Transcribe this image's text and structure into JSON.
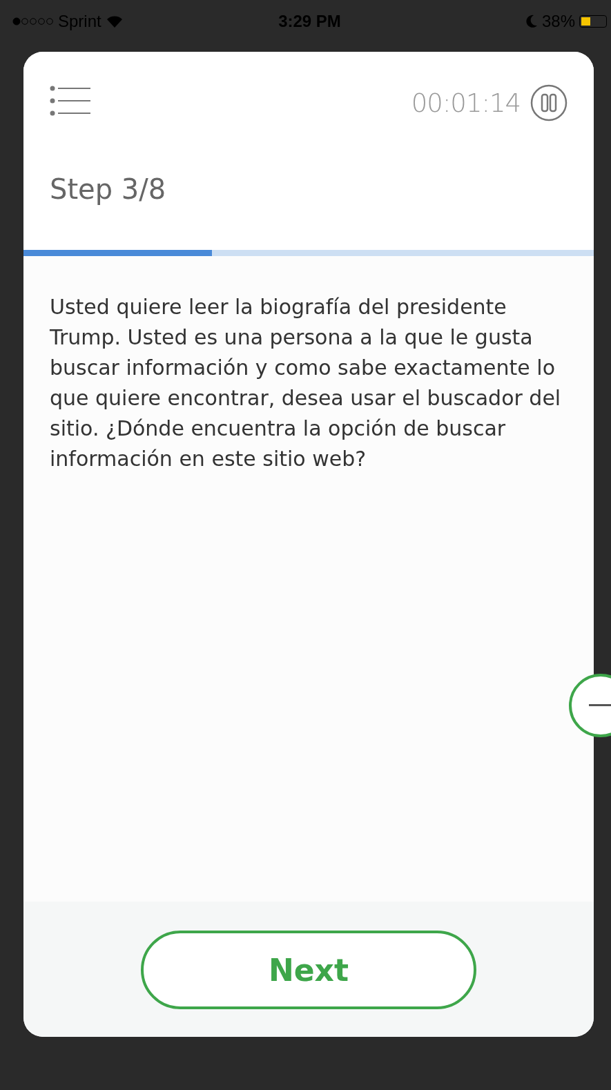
{
  "status_bar": {
    "carrier": "Sprint",
    "time": "3:29 PM",
    "battery": "38%"
  },
  "task_panel": {
    "timer": "00:01:14",
    "paused": false,
    "step": "Step 3/8",
    "progress": {
      "level": 0.33
    },
    "instructions": "Usted quiere leer la biografía del presidente Trump. Usted es una persona a la que le gusta buscar información y como sabe exactamente lo que quiere encontrar, desea usar el buscador del sitio. ¿Dónde encuentra la opción de buscar información en este sitio web?",
    "next_button": "Next"
  }
}
